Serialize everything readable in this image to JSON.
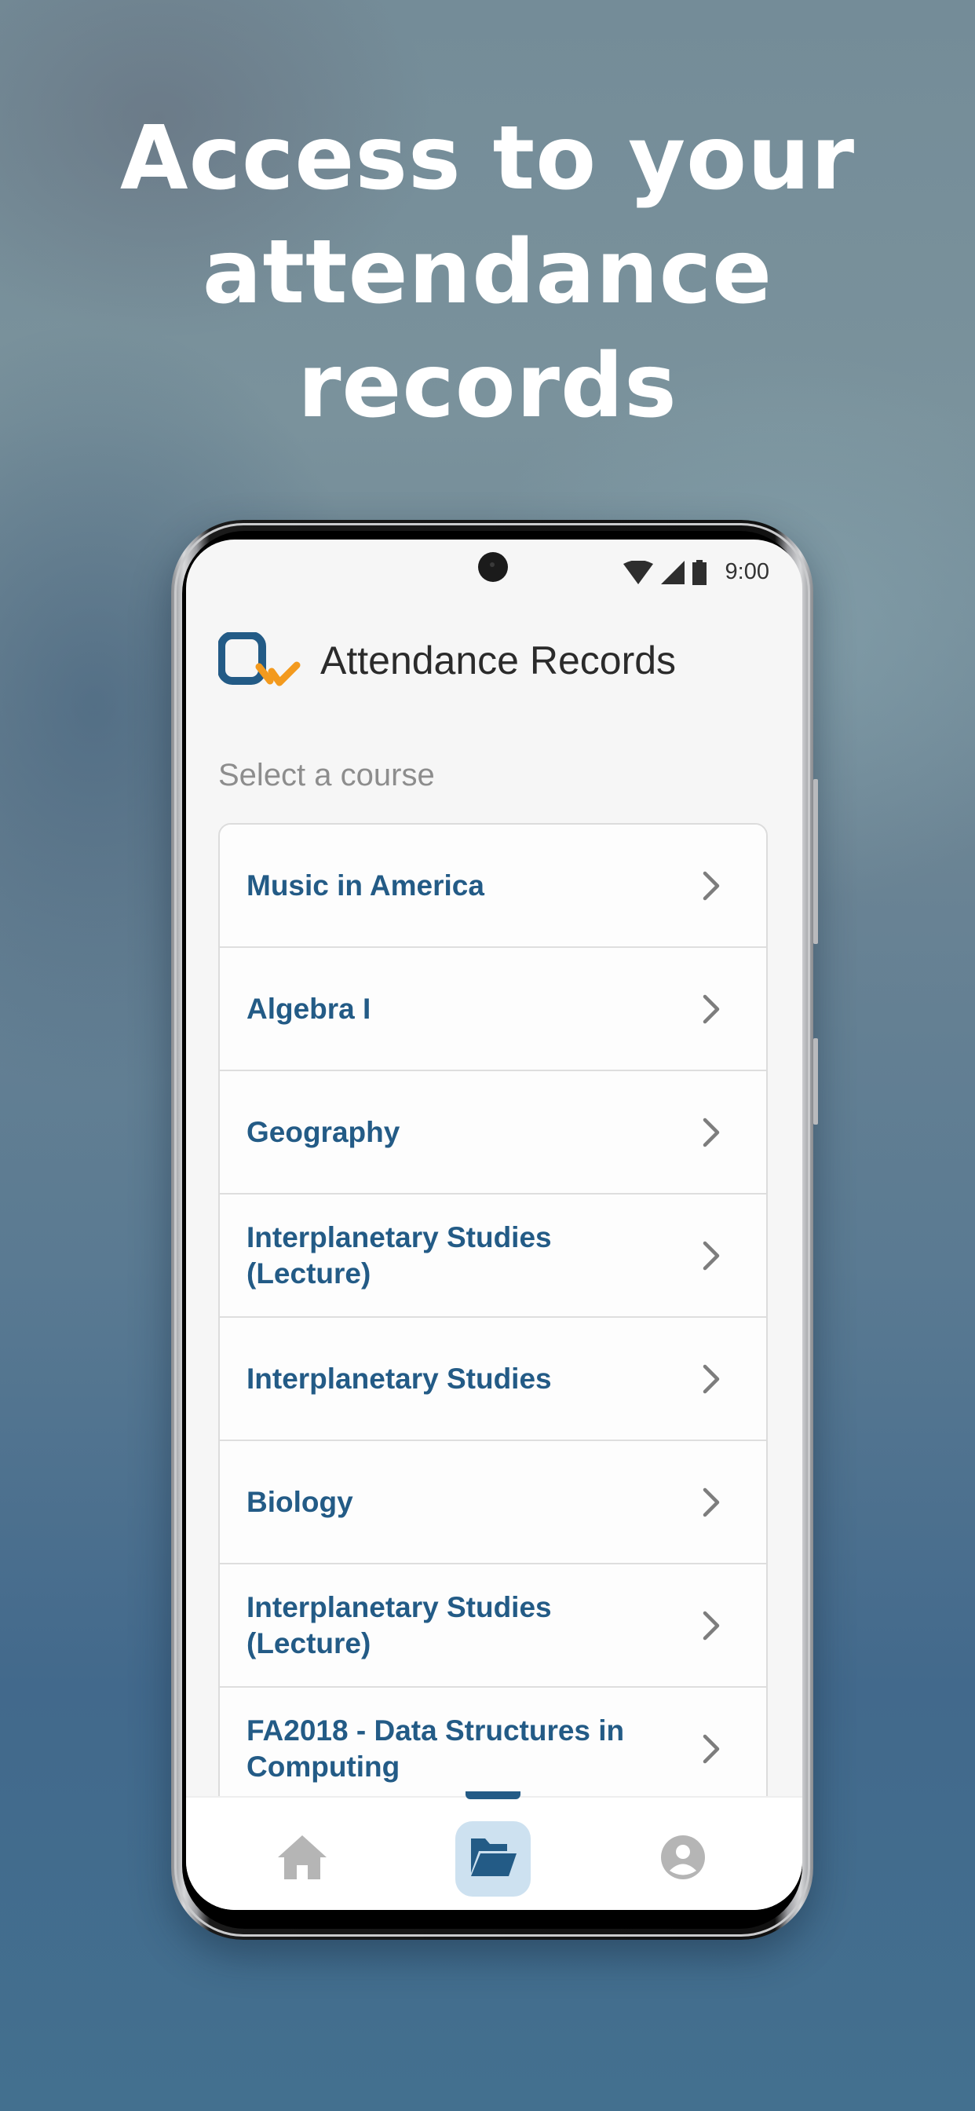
{
  "headline": {
    "lines": [
      "Access to your",
      "attendance",
      "records"
    ]
  },
  "status_bar": {
    "time": "9:00",
    "icons": [
      "wifi-icon",
      "cellular-signal-icon",
      "battery-icon"
    ]
  },
  "app": {
    "logo": "qv-logo",
    "title": "Attendance Records",
    "colors": {
      "brand_blue": "#235b86",
      "brand_orange": "#f39a1e",
      "active_tab_bg": "#cde1f0",
      "inactive_icon": "#b5b5b5"
    }
  },
  "main": {
    "section_label": "Select a course",
    "courses": [
      {
        "name": "Music in America"
      },
      {
        "name": "Algebra I"
      },
      {
        "name": "Geography"
      },
      {
        "name": "Interplanetary Studies (Lecture)"
      },
      {
        "name": "Interplanetary Studies"
      },
      {
        "name": "Biology"
      },
      {
        "name": "Interplanetary Studies (Lecture)"
      },
      {
        "name": "FA2018 - Data Structures in Computing"
      }
    ]
  },
  "bottom_nav": {
    "items": [
      {
        "icon": "home-icon",
        "active": false
      },
      {
        "icon": "folder-open-icon",
        "active": true
      },
      {
        "icon": "account-circle-icon",
        "active": false
      }
    ]
  }
}
